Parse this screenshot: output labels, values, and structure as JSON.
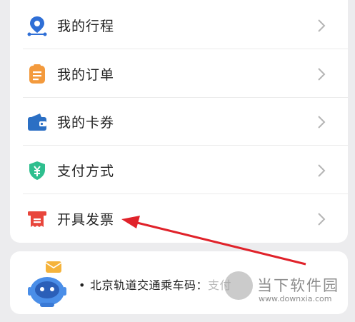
{
  "menu": {
    "items": [
      {
        "label": "我的行程",
        "icon": "location-pin-icon",
        "color": "#2f6fd6"
      },
      {
        "label": "我的订单",
        "icon": "order-clipboard-icon",
        "color": "#f39a3d"
      },
      {
        "label": "我的卡券",
        "icon": "wallet-icon",
        "color": "#2b6fc4"
      },
      {
        "label": "支付方式",
        "icon": "payment-shield-icon",
        "color": "#2fbf8f"
      },
      {
        "label": "开具发票",
        "icon": "invoice-icon",
        "color": "#e8463c"
      }
    ]
  },
  "metro_card": {
    "bullet": "•",
    "text": "北京轨道交通乘车码：",
    "tail": "支付"
  },
  "watermark": {
    "title": "当下软件园",
    "url": "www.downxia.com"
  },
  "colors": {
    "background": "#ececee",
    "card": "#ffffff",
    "arrow": "#e0222a",
    "chevron": "#b5b5b5"
  }
}
